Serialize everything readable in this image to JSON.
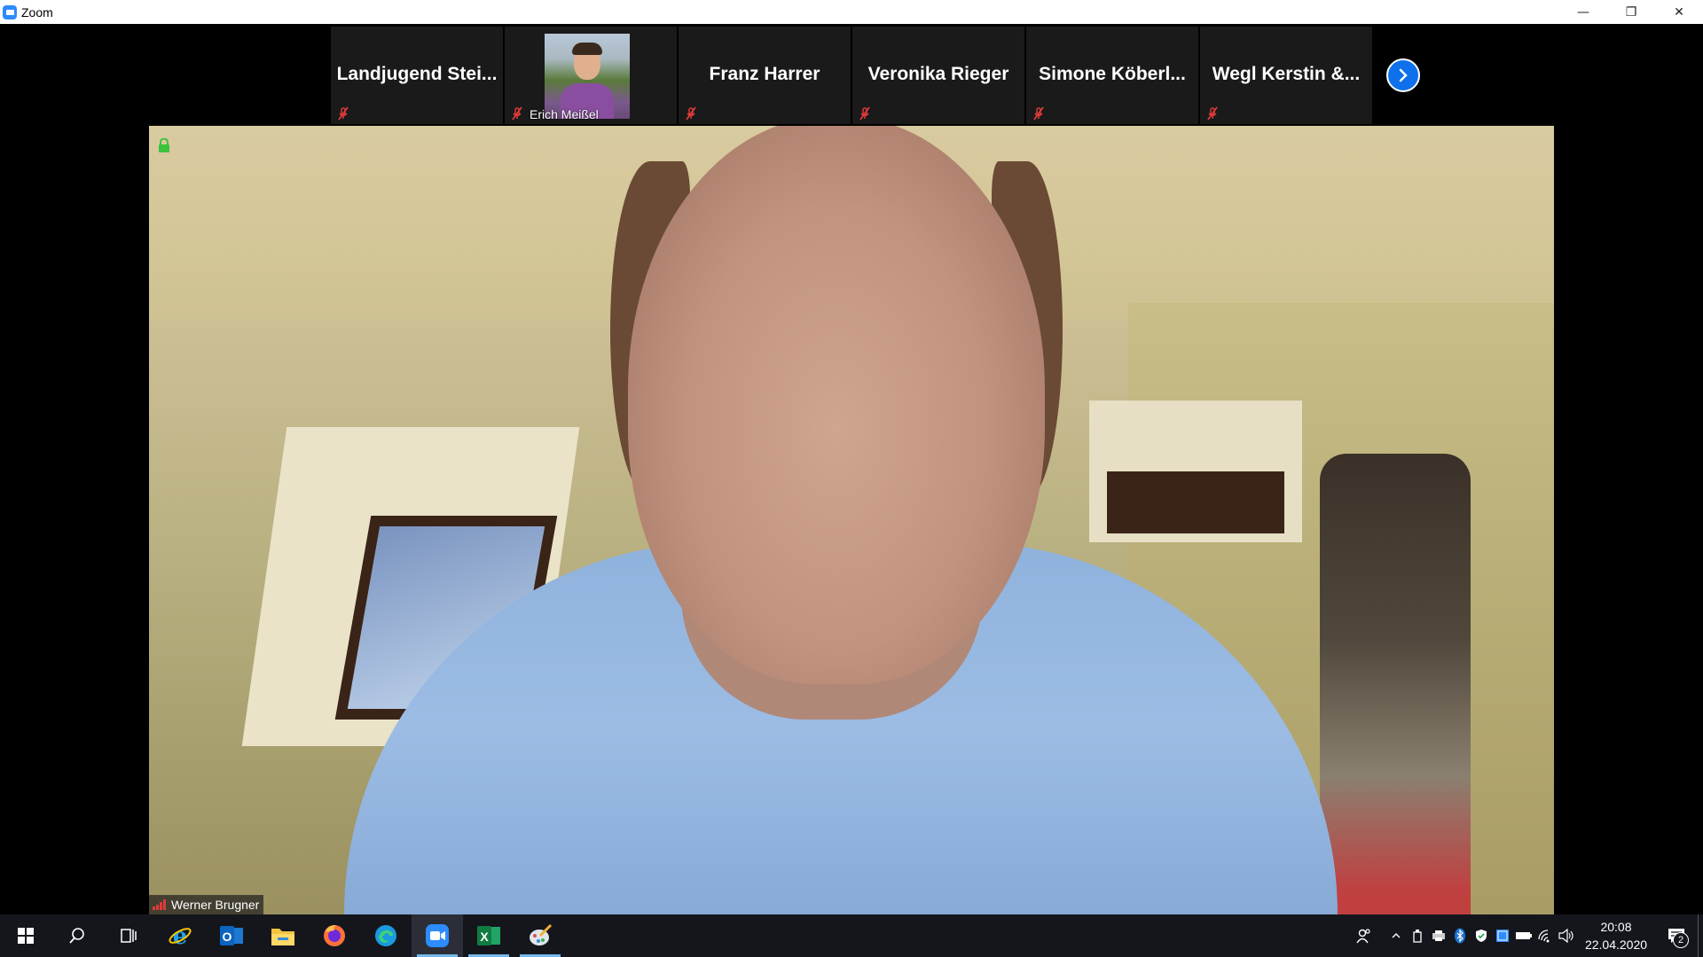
{
  "window": {
    "title": "Zoom",
    "icon": "zoom-app-icon",
    "controls": {
      "minimize": "—",
      "restore": "❐",
      "close": "✕"
    }
  },
  "participants": [
    {
      "name": "Landjugend  Stei...",
      "muted": true,
      "has_video": false
    },
    {
      "name": "Erich Meißel",
      "muted": true,
      "has_video": true
    },
    {
      "name": "Franz Harrer",
      "muted": true,
      "has_video": false
    },
    {
      "name": "Veronika Rieger",
      "muted": true,
      "has_video": false
    },
    {
      "name": "Simone  Köberl...",
      "muted": true,
      "has_video": false
    },
    {
      "name": "Wegl Kerstin &...",
      "muted": true,
      "has_video": false
    }
  ],
  "main_speaker": {
    "name": "Werner Brugner",
    "signal_icon": "signal-strength-icon",
    "lock_icon": "encrypted-lock-icon"
  },
  "taskbar": {
    "apps": [
      {
        "name": "start",
        "icon": "windows-start-icon"
      },
      {
        "name": "search",
        "icon": "search-icon"
      },
      {
        "name": "task-view",
        "icon": "task-view-icon"
      },
      {
        "name": "internet-explorer",
        "icon": "internet-explorer-icon"
      },
      {
        "name": "outlook",
        "icon": "outlook-icon"
      },
      {
        "name": "file-explorer",
        "icon": "file-explorer-icon"
      },
      {
        "name": "firefox",
        "icon": "firefox-icon"
      },
      {
        "name": "edge",
        "icon": "edge-icon"
      },
      {
        "name": "zoom",
        "icon": "zoom-icon"
      },
      {
        "name": "excel",
        "icon": "excel-icon"
      },
      {
        "name": "paint",
        "icon": "paint-icon"
      }
    ],
    "tray": {
      "time": "20:08",
      "date": "22.04.2020",
      "notifications": "2"
    }
  },
  "colors": {
    "zoom_blue": "#2d8cff",
    "next_button": "#0e71eb",
    "mute_red": "#e03a3a",
    "lock_green": "#3cc33c",
    "taskbar": "#14161c"
  }
}
